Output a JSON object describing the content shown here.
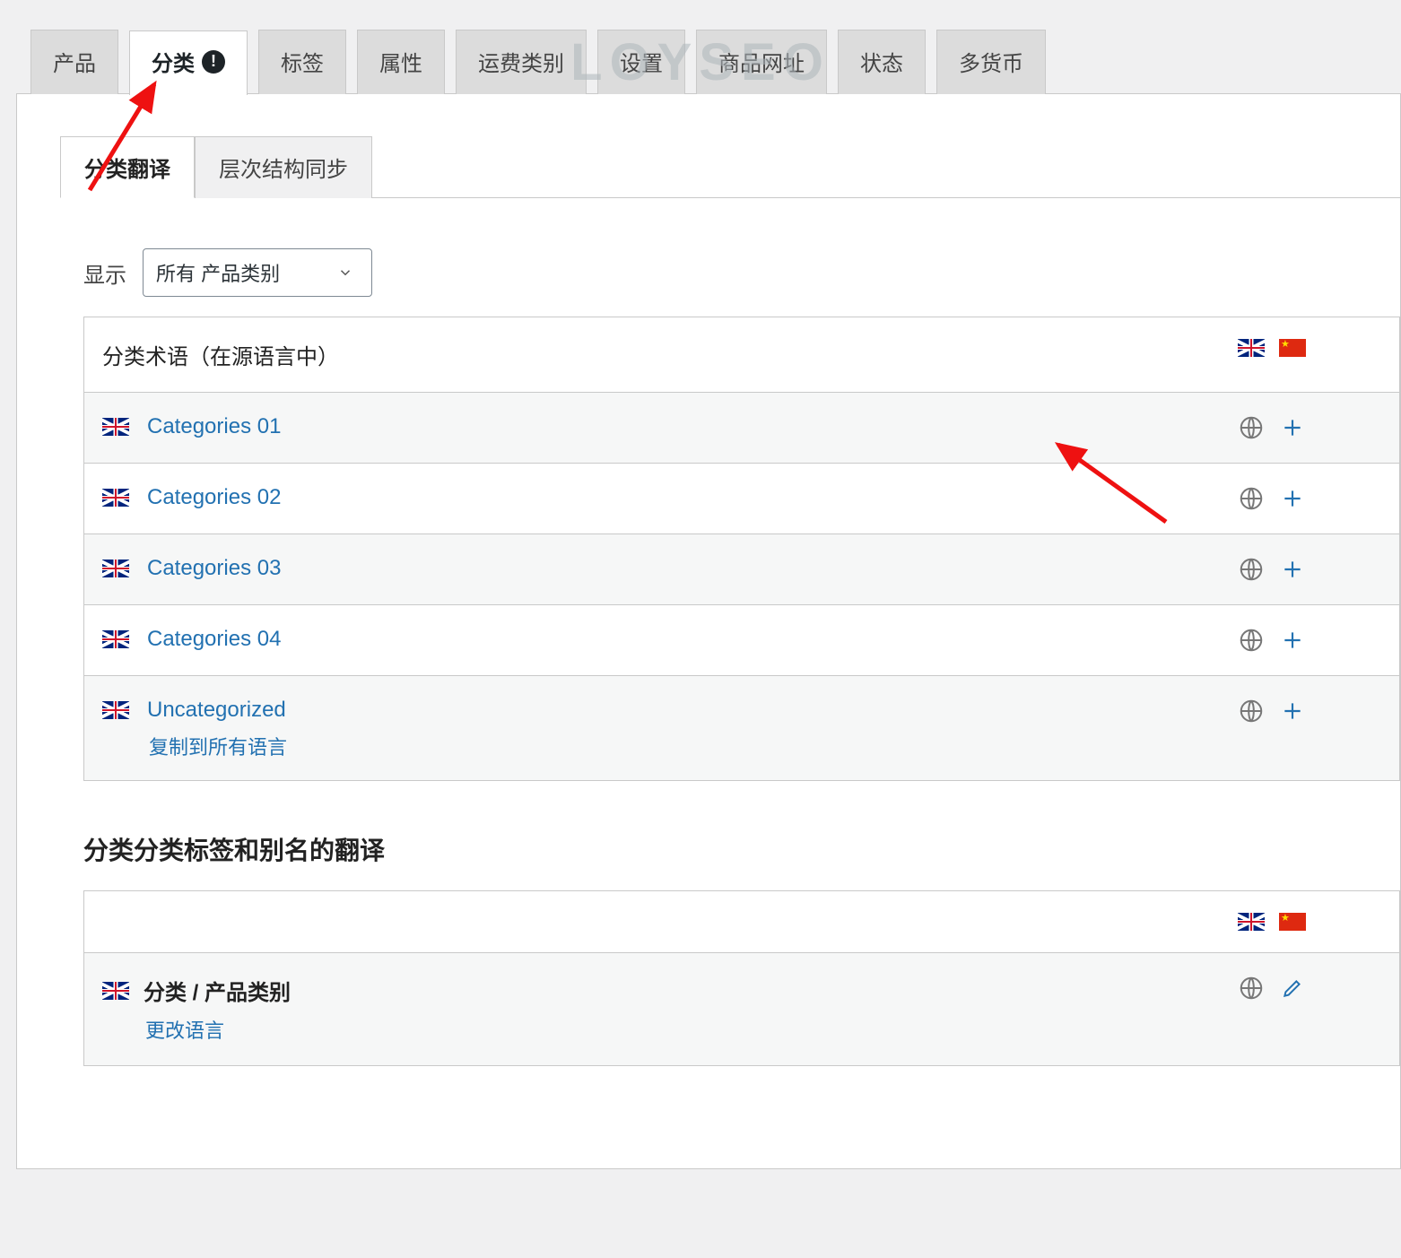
{
  "watermark": "LOYSEO",
  "tabs": {
    "products": "产品",
    "categories": "分类",
    "tags": "标签",
    "attributes": "属性",
    "shipping_classes": "运费类别",
    "settings": "设置",
    "product_urls": "商品网址",
    "status": "状态",
    "multi_currency": "多货币",
    "alert_badge": "!"
  },
  "subtabs": {
    "translate": "分类翻译",
    "sync": "层次结构同步"
  },
  "filter": {
    "label": "显示",
    "selected": "所有 产品类别"
  },
  "table": {
    "header_term": "分类术语（在源语言中）",
    "rows": [
      {
        "label": "Categories 01",
        "action": "add"
      },
      {
        "label": "Categories 02",
        "action": "add"
      },
      {
        "label": "Categories 03",
        "action": "add"
      },
      {
        "label": "Categories 04",
        "action": "add"
      },
      {
        "label": "Uncategorized",
        "action": "add",
        "sublink": "复制到所有语言"
      }
    ]
  },
  "section2": {
    "heading": "分类分类标签和别名的翻译",
    "row_label": "分类 / 产品类别",
    "change_lang": "更改语言"
  }
}
